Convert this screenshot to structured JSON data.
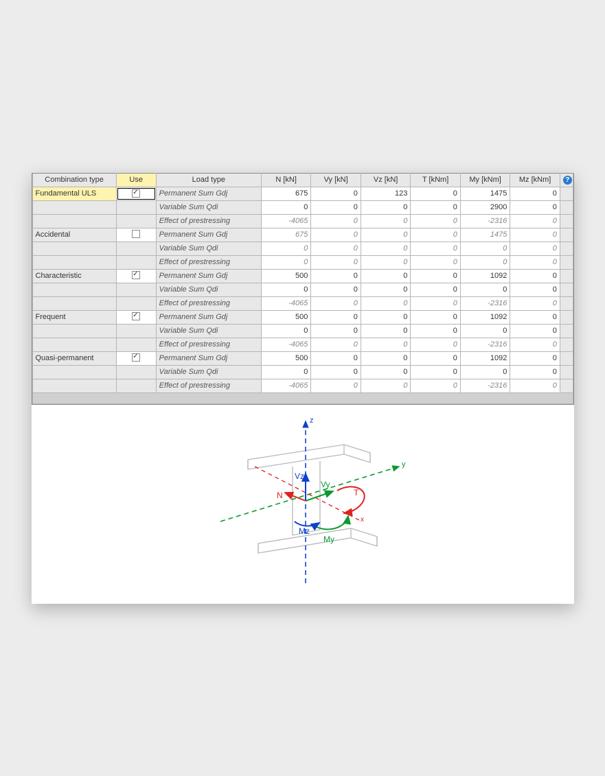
{
  "headers": {
    "combination": "Combination type",
    "use": "Use",
    "loadtype": "Load type",
    "N": "N [kN]",
    "Vy": "Vy [kN]",
    "Vz": "Vz [kN]",
    "T": "T [kNm]",
    "My": "My [kNm]",
    "Mz": "Mz [kNm]"
  },
  "combinations": [
    {
      "name": "Fundamental ULS",
      "selected": true,
      "checked": true,
      "rows": [
        {
          "label": "Permanent Sum Gdj",
          "dim": false,
          "N": "675",
          "Vy": "0",
          "Vz": "123",
          "T": "0",
          "My": "1475",
          "Mz": "0"
        },
        {
          "label": "Variable Sum Qdi",
          "dim": false,
          "N": "0",
          "Vy": "0",
          "Vz": "0",
          "T": "0",
          "My": "2900",
          "Mz": "0"
        },
        {
          "label": "Effect of prestressing",
          "dim": true,
          "N": "-4065",
          "Vy": "0",
          "Vz": "0",
          "T": "0",
          "My": "-2316",
          "Mz": "0"
        }
      ]
    },
    {
      "name": "Accidental",
      "selected": false,
      "checked": false,
      "rows": [
        {
          "label": "Permanent Sum Gdj",
          "dim": true,
          "N": "675",
          "Vy": "0",
          "Vz": "0",
          "T": "0",
          "My": "1475",
          "Mz": "0"
        },
        {
          "label": "Variable Sum Qdi",
          "dim": true,
          "N": "0",
          "Vy": "0",
          "Vz": "0",
          "T": "0",
          "My": "0",
          "Mz": "0"
        },
        {
          "label": "Effect of prestressing",
          "dim": true,
          "N": "0",
          "Vy": "0",
          "Vz": "0",
          "T": "0",
          "My": "0",
          "Mz": "0"
        }
      ]
    },
    {
      "name": "Characteristic",
      "selected": false,
      "checked": true,
      "rows": [
        {
          "label": "Permanent Sum Gdj",
          "dim": false,
          "N": "500",
          "Vy": "0",
          "Vz": "0",
          "T": "0",
          "My": "1092",
          "Mz": "0"
        },
        {
          "label": "Variable Sum Qdi",
          "dim": false,
          "N": "0",
          "Vy": "0",
          "Vz": "0",
          "T": "0",
          "My": "0",
          "Mz": "0"
        },
        {
          "label": "Effect of prestressing",
          "dim": true,
          "N": "-4065",
          "Vy": "0",
          "Vz": "0",
          "T": "0",
          "My": "-2316",
          "Mz": "0"
        }
      ]
    },
    {
      "name": "Frequent",
      "selected": false,
      "checked": true,
      "rows": [
        {
          "label": "Permanent Sum Gdj",
          "dim": false,
          "N": "500",
          "Vy": "0",
          "Vz": "0",
          "T": "0",
          "My": "1092",
          "Mz": "0"
        },
        {
          "label": "Variable Sum Qdi",
          "dim": false,
          "N": "0",
          "Vy": "0",
          "Vz": "0",
          "T": "0",
          "My": "0",
          "Mz": "0"
        },
        {
          "label": "Effect of prestressing",
          "dim": true,
          "N": "-4065",
          "Vy": "0",
          "Vz": "0",
          "T": "0",
          "My": "-2316",
          "Mz": "0"
        }
      ]
    },
    {
      "name": "Quasi-permanent",
      "selected": false,
      "checked": true,
      "rows": [
        {
          "label": "Permanent Sum Gdj",
          "dim": false,
          "N": "500",
          "Vy": "0",
          "Vz": "0",
          "T": "0",
          "My": "1092",
          "Mz": "0"
        },
        {
          "label": "Variable Sum Qdi",
          "dim": false,
          "N": "0",
          "Vy": "0",
          "Vz": "0",
          "T": "0",
          "My": "0",
          "Mz": "0"
        },
        {
          "label": "Effect of prestressing",
          "dim": true,
          "N": "-4065",
          "Vy": "0",
          "Vz": "0",
          "T": "0",
          "My": "-2316",
          "Mz": "0"
        }
      ]
    }
  ],
  "diagram": {
    "z": "z",
    "y": "y",
    "x": "x",
    "N": "N",
    "Vy": "Vy",
    "Vz": "Vz",
    "T": "T",
    "My": "My",
    "Mz": "Mz"
  }
}
